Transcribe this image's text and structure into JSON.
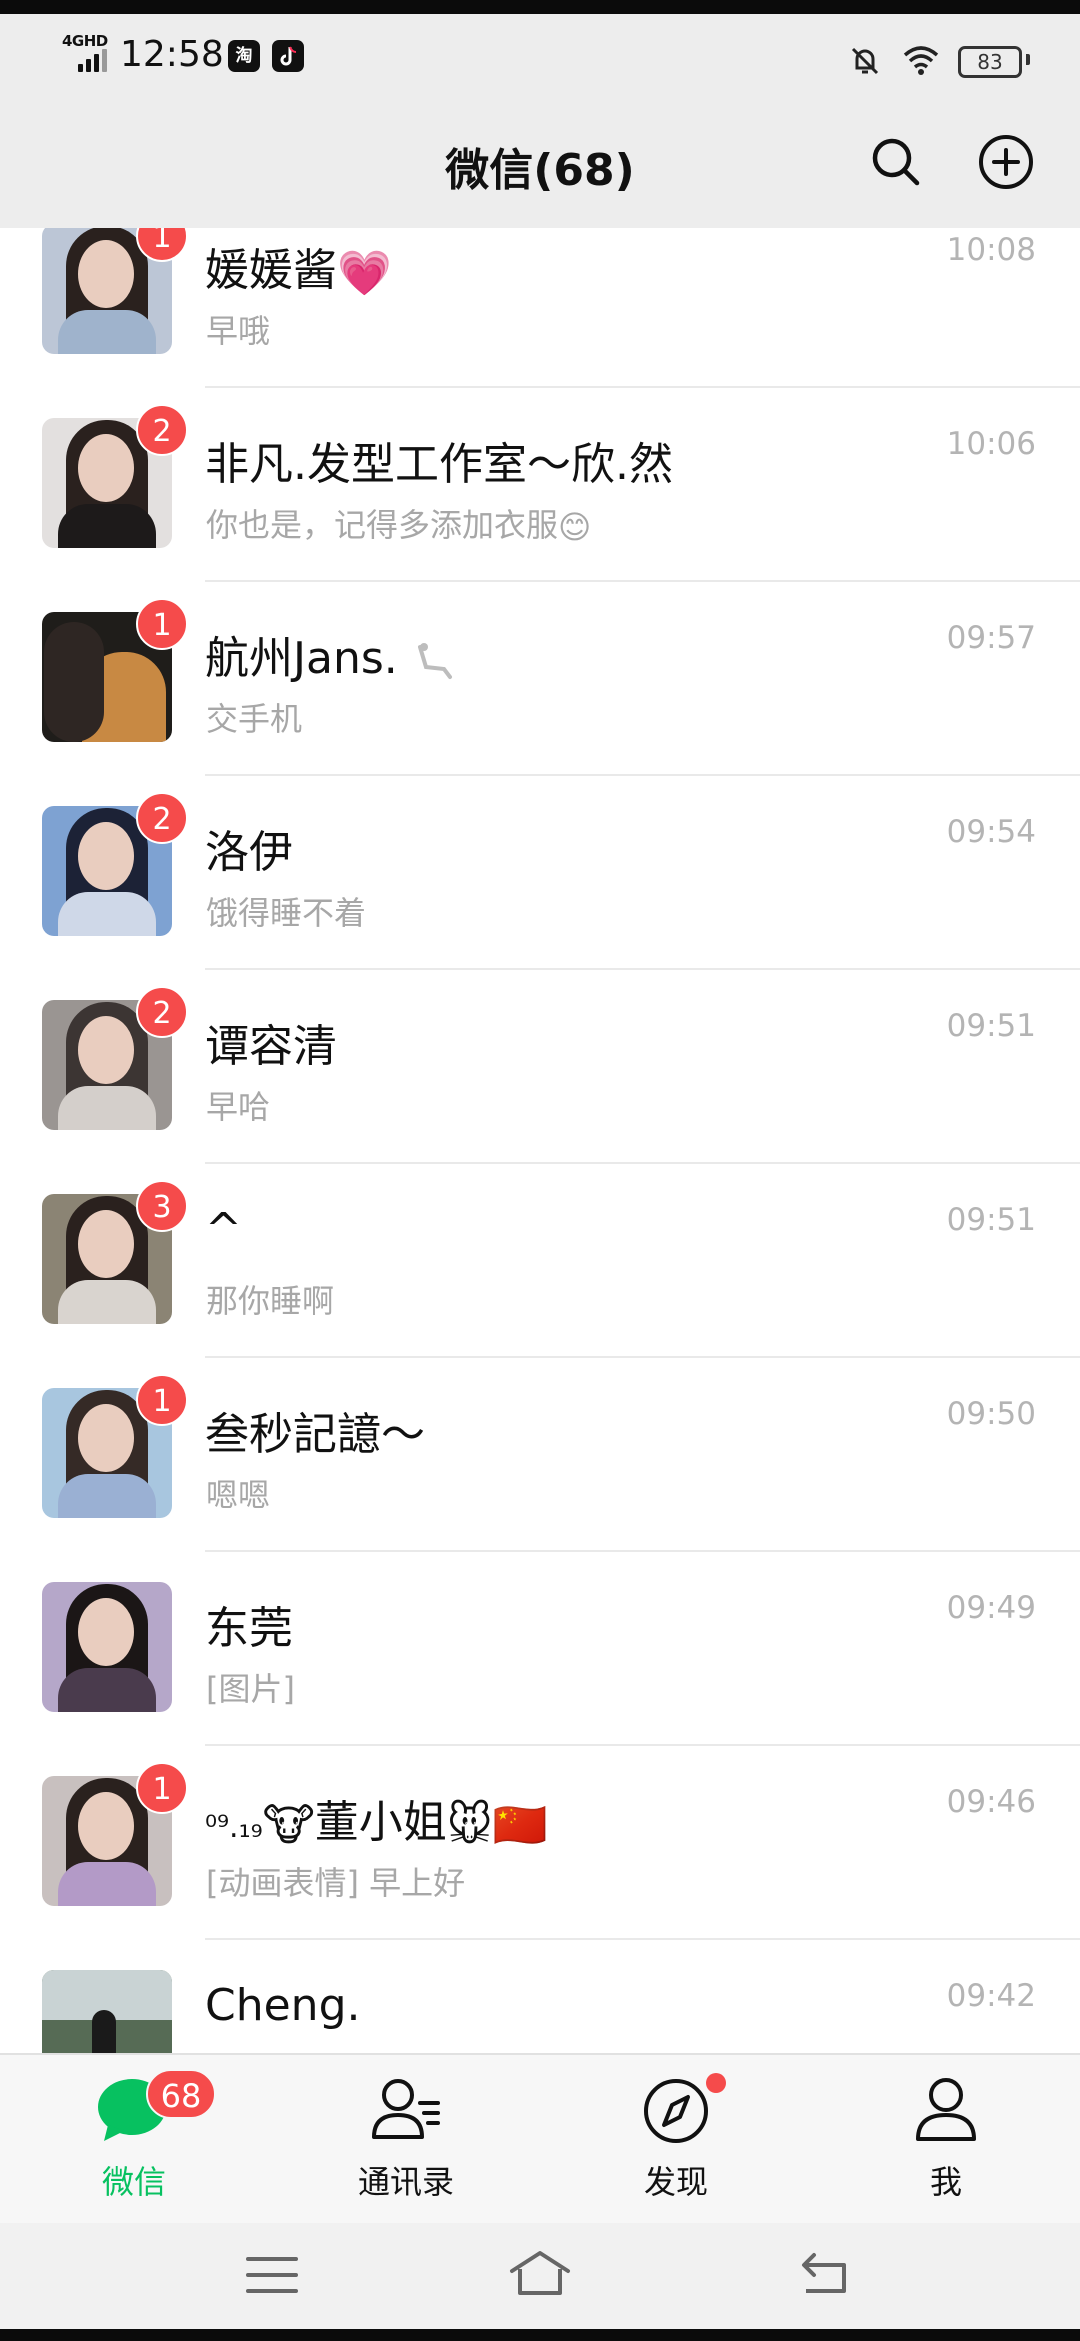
{
  "status_bar": {
    "network": "4GHD",
    "time": "12:58",
    "taobao_icon_text": "淘",
    "battery": "83",
    "icons": [
      "taobao-icon",
      "douyin-icon",
      "mute-icon",
      "wifi-icon",
      "battery-icon"
    ]
  },
  "header": {
    "title": "微信(68)",
    "icons": [
      "search-icon",
      "add-circle-icon"
    ]
  },
  "chats": [
    {
      "name": "媛媛酱",
      "name_emoji": "💗",
      "preview": "早哦",
      "time": "10:08",
      "unread": "1",
      "bg": "#bcc6d6",
      "body": "#9fb3cc"
    },
    {
      "name": "非凡.发型工作室～欣.然",
      "name_emoji": "",
      "preview": "你也是，记得多添加衣服",
      "preview_emoji": "😊",
      "time": "10:06",
      "unread": "2",
      "bg": "#e3e0df",
      "body": "#1d1a1a"
    },
    {
      "name": "航州Jans.",
      "name_emoji": "",
      "preview": "交手机",
      "time": "09:57",
      "unread": "1",
      "bg": "#1f1d1a",
      "body": "#c88943"
    },
    {
      "name": "洛伊",
      "name_emoji": "",
      "preview": "饿得睡不着",
      "time": "09:54",
      "unread": "2",
      "bg": "#7ea2d2",
      "body": "#cfd8e8"
    },
    {
      "name": "谭容清",
      "name_emoji": "",
      "preview": "早哈",
      "time": "09:51",
      "unread": "2",
      "bg": "#9a9592",
      "body": "#d4cfcb"
    },
    {
      "name": "^",
      "name_emoji": "",
      "preview": "那你睡啊",
      "time": "09:51",
      "unread": "3",
      "bg": "#8b8474",
      "body": "#d9d4cf"
    },
    {
      "name": "叁秒記譩～",
      "name_emoji": "",
      "preview": "嗯嗯",
      "time": "09:50",
      "unread": "1",
      "bg": "#a8c6df",
      "body": "#9ab0d3"
    },
    {
      "name": "东莞",
      "name_emoji": "",
      "preview": "[图片]",
      "time": "09:49",
      "unread": "",
      "bg": "#b5a7c9",
      "body": "#4a3b4d"
    },
    {
      "name_prefix": "⁰⁹.₁₉",
      "name_prefix_emoji": "🐮",
      "name": "董小姐",
      "name_emoji": "🐭🇨🇳",
      "preview": "[动画表情] 早上好",
      "time": "09:46",
      "unread": "1",
      "bg": "#c8c0bf",
      "body": "#b39ac7"
    },
    {
      "name": "Cheng.",
      "name_emoji": "",
      "preview": "",
      "time": "09:42",
      "unread": "",
      "bg": "#566b55",
      "body": "#2d3329"
    }
  ],
  "tabs": [
    {
      "label": "微信",
      "badge": "68",
      "icon": "chat-bubble-icon",
      "active": true
    },
    {
      "label": "通讯录",
      "icon": "contacts-icon"
    },
    {
      "label": "发现",
      "icon": "compass-icon",
      "dot": true
    },
    {
      "label": "我",
      "icon": "person-icon"
    }
  ],
  "nav": [
    "menu-icon",
    "home-icon",
    "back-icon"
  ],
  "colors": {
    "accent": "#07c160",
    "badge": "#f54b4b",
    "header_bg": "#ededed"
  }
}
